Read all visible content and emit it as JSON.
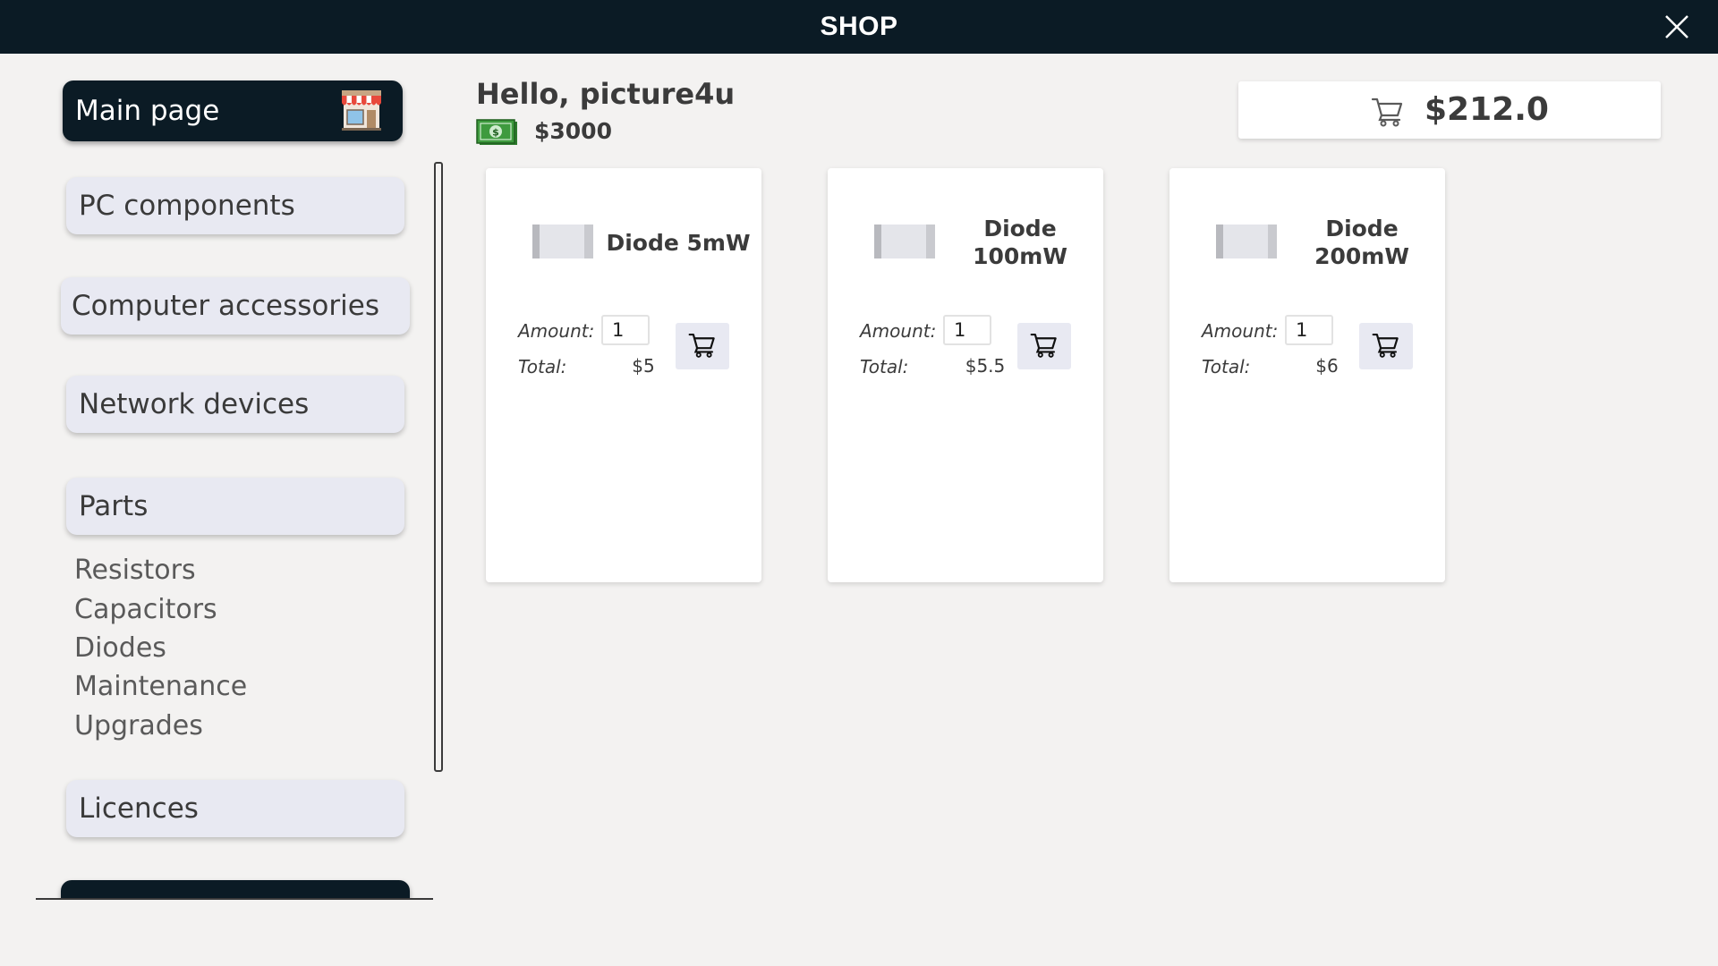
{
  "window": {
    "title": "SHOP",
    "close_icon": "close-icon"
  },
  "sidebar": {
    "main_page": {
      "label": "Main page",
      "icon": "shop-icon"
    },
    "categories": [
      {
        "label": "PC components"
      },
      {
        "label": "Computer accessories"
      },
      {
        "label": "Network devices"
      },
      {
        "label": "Parts"
      }
    ],
    "subcategories": [
      "Resistors",
      "Capacitors",
      "Diodes",
      "Maintenance",
      "Upgrades"
    ],
    "licences": {
      "label": "Licences"
    }
  },
  "header": {
    "greeting": "Hello, picture4u",
    "balance": "$3000",
    "money_icon": "money-icon"
  },
  "cart": {
    "total": "$212.0",
    "icon": "cart-icon"
  },
  "labels": {
    "amount": "Amount:",
    "total": "Total:"
  },
  "products": [
    {
      "name": "Diode 5mW",
      "amount": "1",
      "total": "$5"
    },
    {
      "name": "Diode 100mW",
      "amount": "1",
      "total": "$5.5"
    },
    {
      "name": "Diode 200mW",
      "amount": "1",
      "total": "$6"
    }
  ],
  "colors": {
    "dark": "#0b1b25",
    "background": "#f3f2f1",
    "button_light": "#e8e9f2",
    "text": "#3b3b3b"
  }
}
